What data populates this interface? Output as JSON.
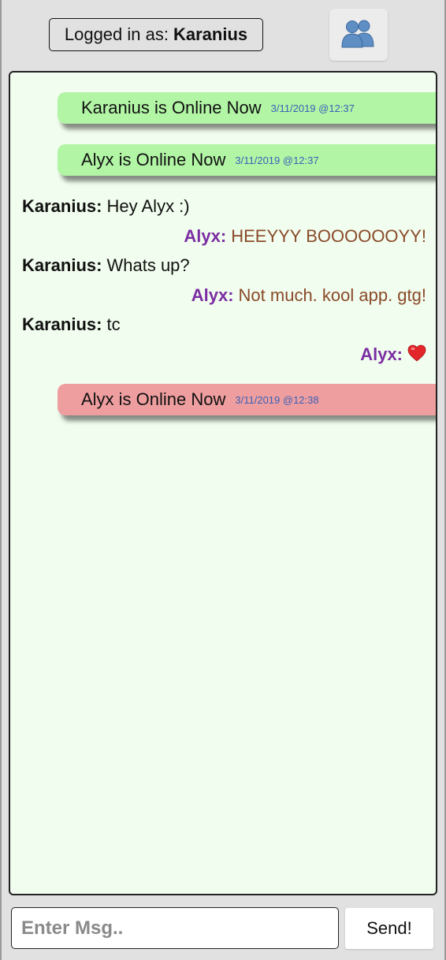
{
  "header": {
    "logged_in_label": "Logged in as:",
    "username": "Karanius",
    "users_button_icon": "users-icon"
  },
  "feed": {
    "notices": [
      {
        "text": "Karanius is Online Now",
        "time": "3/11/2019 @12:37",
        "status": "online"
      },
      {
        "text": "Alyx is Online Now",
        "time": "3/11/2019 @12:37",
        "status": "online"
      },
      {
        "text": "Alyx is Online Now",
        "time": "3/11/2019 @12:38",
        "status": "offline"
      }
    ],
    "messages": [
      {
        "sender": "Karanius:",
        "text": "Hey Alyx :)",
        "side": "left"
      },
      {
        "sender": "Alyx:",
        "text": "HEEYYY BOOOOOOYY!",
        "side": "right"
      },
      {
        "sender": "Karanius:",
        "text": "Whats up?",
        "side": "left"
      },
      {
        "sender": "Alyx:",
        "text": "Not much. kool app. gtg!",
        "side": "right"
      },
      {
        "sender": "Karanius:",
        "text": "tc",
        "side": "left"
      },
      {
        "sender": "Alyx:",
        "text": "",
        "icon": "heart-icon",
        "side": "right"
      }
    ]
  },
  "composer": {
    "placeholder": "Enter Msg..",
    "value": "",
    "send_label": "Send!"
  },
  "colors": {
    "online_notice": "#b2f5a5",
    "offline_notice": "#ef9e9f",
    "chat_background": "#f1fdee",
    "remote_sender": "#7b2da3",
    "remote_text": "#8a4a2a",
    "timestamp": "#3a60b8"
  }
}
